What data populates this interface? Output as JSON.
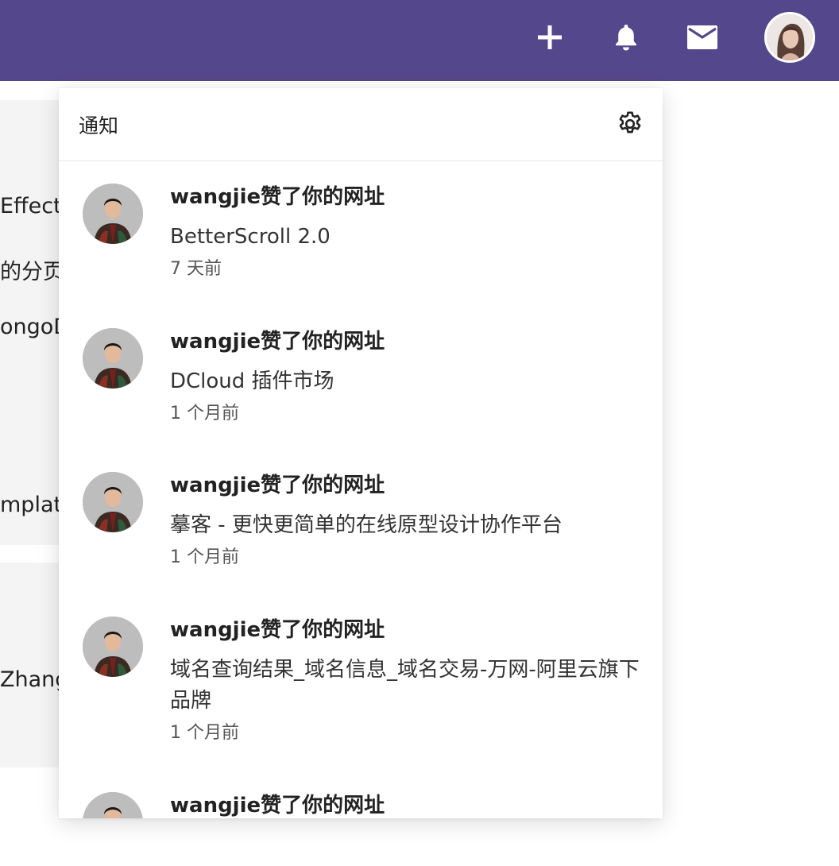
{
  "header": {
    "icons": [
      "plus-icon",
      "bell-icon",
      "mail-icon"
    ],
    "bg_color": "#55478b"
  },
  "background": {
    "fragments": [
      "Effect",
      "的分页",
      "ongoD",
      "mplate",
      "Zhang"
    ]
  },
  "notifications_panel": {
    "title": "通知",
    "items": [
      {
        "title": "wangjie赞了你的网址",
        "site": "BetterScroll 2.0",
        "time": "7 天前"
      },
      {
        "title": "wangjie赞了你的网址",
        "site": "DCloud 插件市场",
        "time": "1 个月前"
      },
      {
        "title": "wangjie赞了你的网址",
        "site": "摹客 - 更快更简单的在线原型设计协作平台",
        "time": "1 个月前"
      },
      {
        "title": "wangjie赞了你的网址",
        "site": "域名查询结果_域名信息_域名交易-万网-阿里云旗下品牌",
        "time": "1 个月前"
      },
      {
        "title": "wangjie赞了你的网址",
        "site": "",
        "time": ""
      }
    ]
  }
}
